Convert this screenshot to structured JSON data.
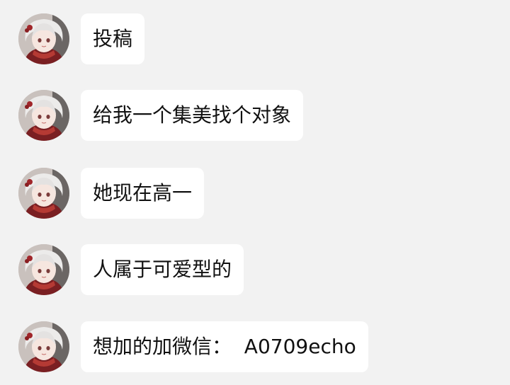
{
  "chat": {
    "sender": {
      "avatar_icon": "anime-girl-avatar-icon"
    },
    "messages": [
      {
        "text": "投稿"
      },
      {
        "text": "给我一个集美找个对象"
      },
      {
        "text": "她现在高一"
      },
      {
        "text": "人属于可爱型的"
      },
      {
        "text": "想加的加微信：  A0709echo"
      }
    ]
  },
  "colors": {
    "background": "#f2f2f2",
    "bubble": "#ffffff",
    "text": "#111111"
  }
}
